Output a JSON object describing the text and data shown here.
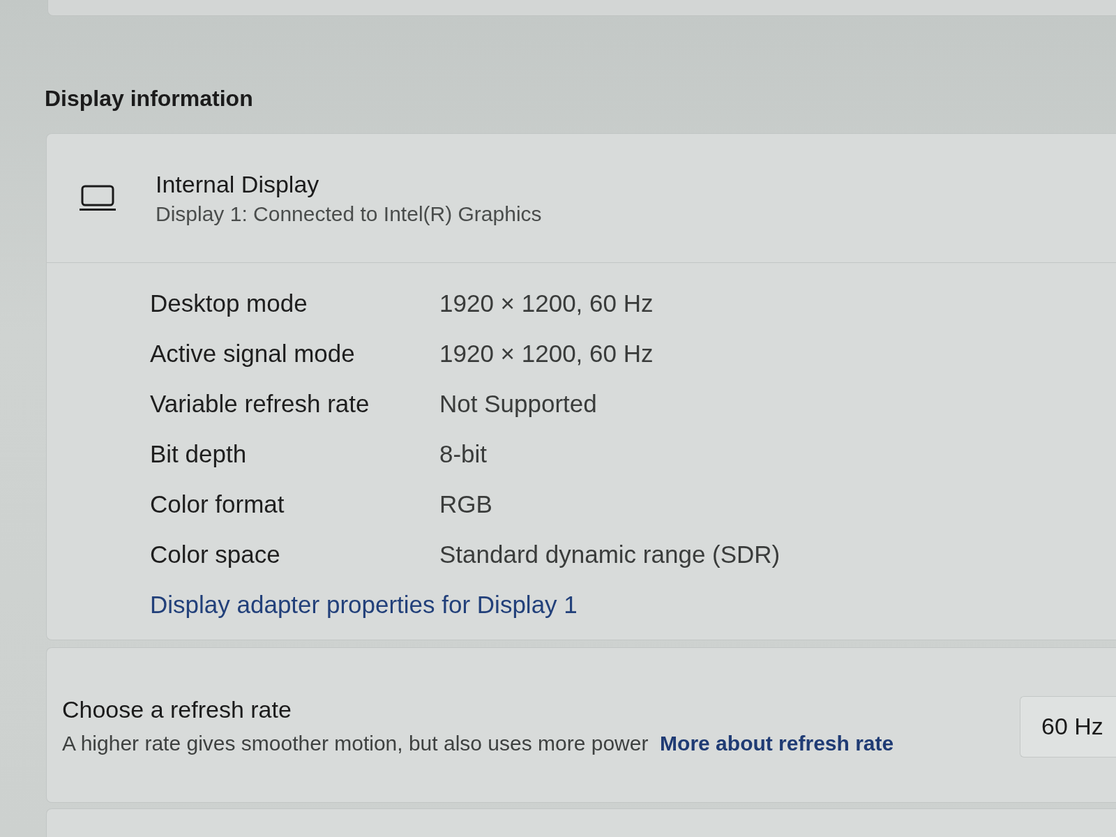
{
  "section_title": "Display information",
  "display": {
    "name": "Internal Display",
    "description": "Display 1: Connected to Intel(R) Graphics"
  },
  "properties": [
    {
      "label": "Desktop mode",
      "value": "1920 × 1200, 60 Hz"
    },
    {
      "label": "Active signal mode",
      "value": "1920 × 1200, 60 Hz"
    },
    {
      "label": "Variable refresh rate",
      "value": "Not Supported"
    },
    {
      "label": "Bit depth",
      "value": "8-bit"
    },
    {
      "label": "Color format",
      "value": "RGB"
    },
    {
      "label": "Color space",
      "value": "Standard dynamic range (SDR)"
    }
  ],
  "adapter_link": "Display adapter properties for Display 1",
  "refresh_rate": {
    "title": "Choose a refresh rate",
    "description": "A higher rate gives smoother motion, but also uses more power",
    "link": "More about refresh rate",
    "value": "60 Hz"
  }
}
